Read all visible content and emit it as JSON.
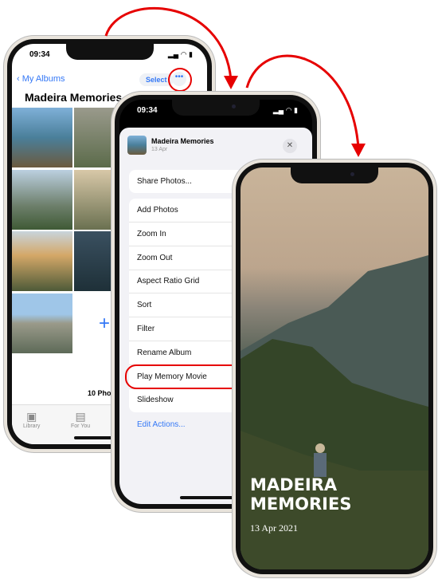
{
  "status": {
    "time": "09:34"
  },
  "album": {
    "back_label": "My Albums",
    "select_label": "Select",
    "more_icon": "ellipsis-icon",
    "title": "Madeira Memories",
    "count": "10 Photos",
    "tabs": [
      "Library",
      "For You"
    ]
  },
  "sheet": {
    "title": "Madeira Memories",
    "date": "13 Apr",
    "share": "Share Photos...",
    "items": [
      "Add Photos",
      "Zoom In",
      "Zoom Out",
      "Aspect Ratio Grid",
      "Sort",
      "Filter",
      "Rename Album",
      "Play Memory Movie",
      "Slideshow"
    ],
    "edit_actions": "Edit Actions..."
  },
  "movie": {
    "title_line1": "MADEIRA",
    "title_line2": "MEMORIES",
    "date": "13 Apr 2021"
  },
  "colors": {
    "accent": "#3478f6",
    "highlight": "#e60000"
  }
}
